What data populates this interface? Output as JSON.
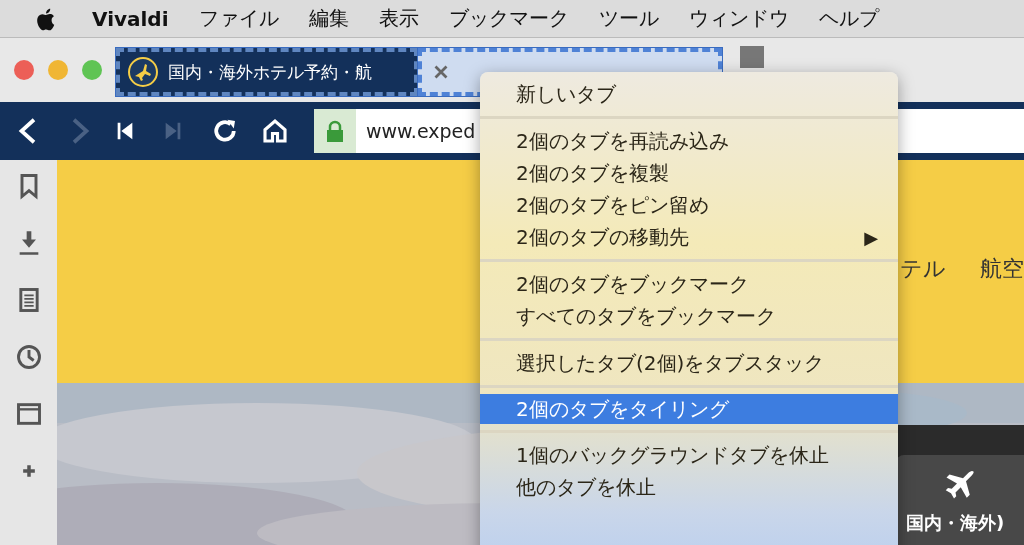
{
  "menu_bar": {
    "app_name": "Vivaldi",
    "items": [
      "ファイル",
      "編集",
      "表示",
      "ブックマーク",
      "ツール",
      "ウィンドウ",
      "ヘルプ"
    ]
  },
  "tabs": [
    {
      "title": "国内・海外ホテル予約・航",
      "active": true,
      "selected": true
    },
    {
      "active": false,
      "selected": true
    }
  ],
  "address_bar": {
    "url": "www.exped",
    "forward_disabled": true,
    "fast_forward_disabled": true
  },
  "page": {
    "nav_items": [
      "テル",
      "航空"
    ],
    "card_label": "国内・海外)"
  },
  "context_menu": {
    "groups": [
      [
        {
          "label": "新しいタブ",
          "selected": false
        }
      ],
      [
        {
          "label": "2個のタブを再読み込み",
          "selected": false
        },
        {
          "label": "2個のタブを複製",
          "selected": false
        },
        {
          "label": "2個のタブをピン留め",
          "selected": false
        },
        {
          "label": "2個のタブの移動先",
          "selected": false,
          "submenu": "▶"
        }
      ],
      [
        {
          "label": "2個のタブをブックマーク",
          "selected": false
        },
        {
          "label": "すべてのタブをブックマーク",
          "selected": false
        }
      ],
      [
        {
          "label": "選択したタブ(2個)をタブスタック",
          "selected": false
        }
      ],
      [
        {
          "label": "2個のタブをタイリング",
          "selected": true
        }
      ],
      [
        {
          "label": "1個のバックグラウンドタブを休止",
          "selected": false
        },
        {
          "label": "他のタブを休止",
          "selected": false
        }
      ]
    ]
  }
}
